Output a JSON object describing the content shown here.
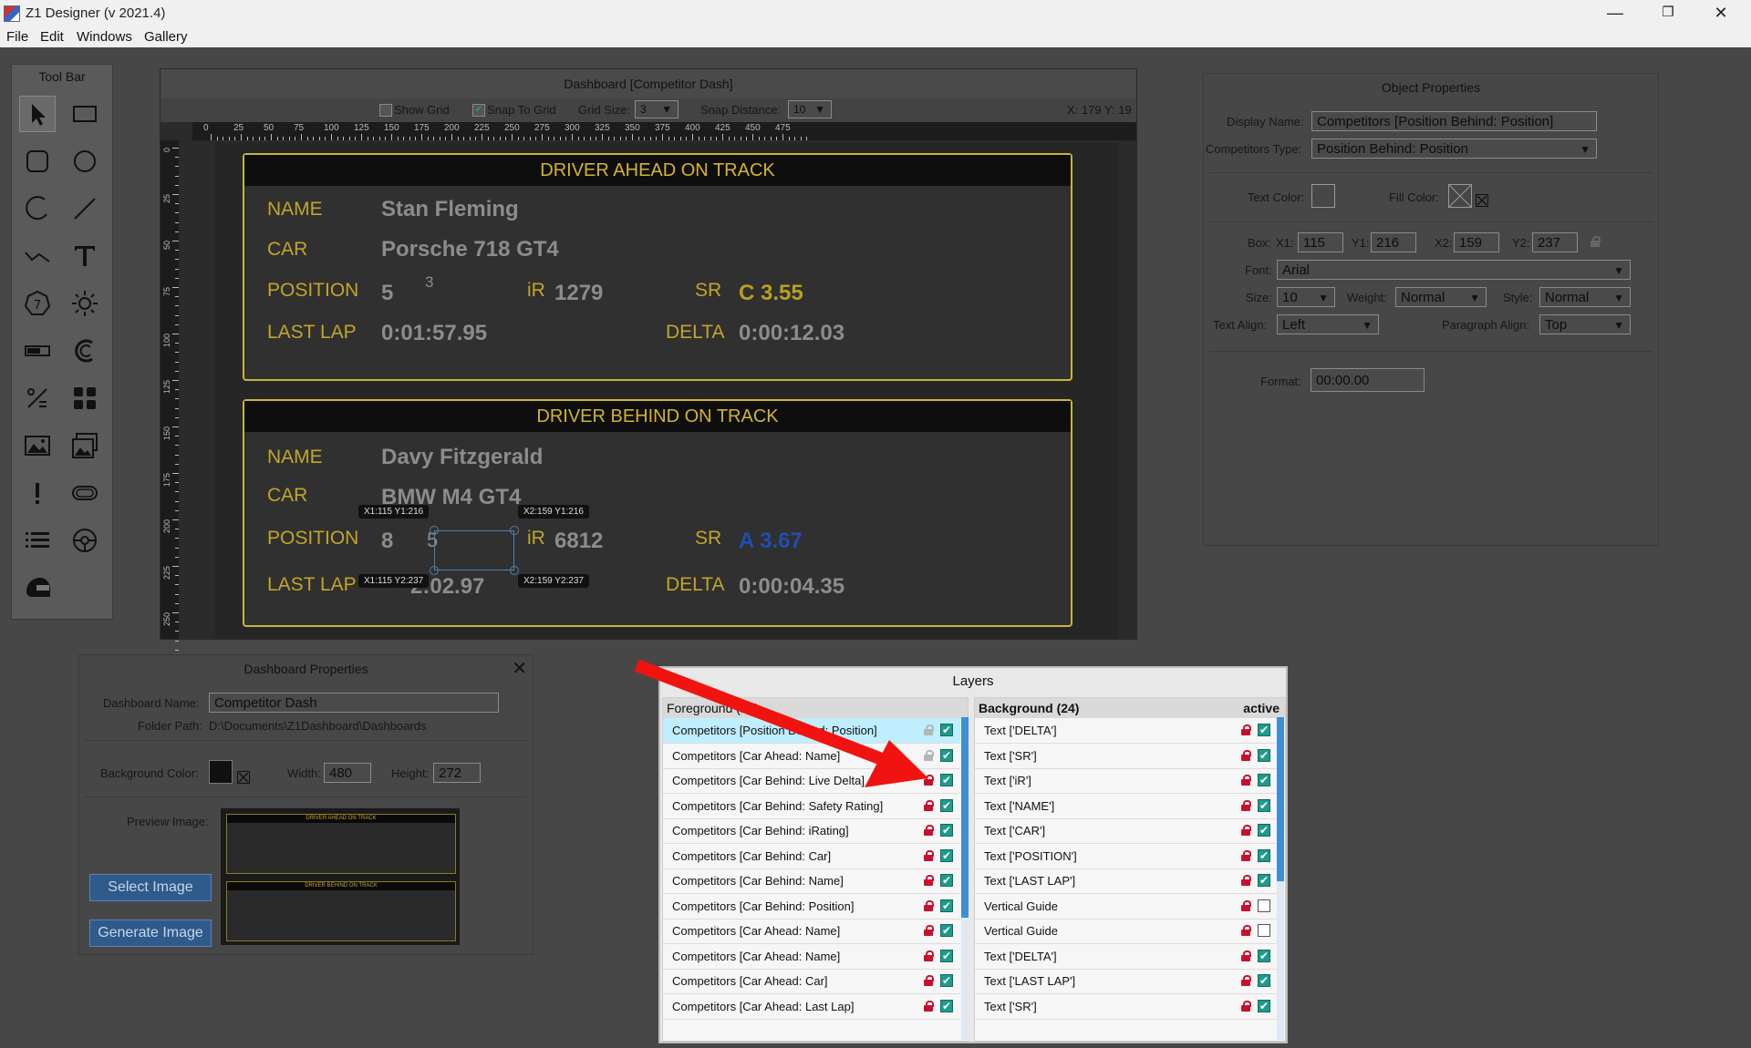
{
  "window": {
    "title": "Z1 Designer (v 2021.4)",
    "minimize": "—",
    "restore": "❐",
    "close": "✕"
  },
  "menu": [
    "File",
    "Edit",
    "Windows",
    "Gallery"
  ],
  "toolbar": {
    "title": "Tool Bar"
  },
  "designer": {
    "title": "Dashboard [Competitor Dash]",
    "show_grid": "Show Grid",
    "snap_to_grid": "Snap To Grid",
    "grid_size_label": "Grid Size:",
    "grid_size": "3",
    "snap_distance_label": "Snap Distance:",
    "snap_distance": "10",
    "coords": "X: 179 Y: 19",
    "ruler_h": [
      "0",
      "25",
      "50",
      "75",
      "100",
      "125",
      "150",
      "175",
      "200",
      "225",
      "250",
      "275",
      "300",
      "325",
      "350",
      "375",
      "400",
      "425",
      "450",
      "475"
    ],
    "ruler_v": [
      "0",
      "25",
      "50",
      "75",
      "100",
      "125",
      "150",
      "175",
      "200",
      "225",
      "250"
    ]
  },
  "dashboard": {
    "ahead": {
      "header": "DRIVER AHEAD ON TRACK",
      "name_label": "NAME",
      "name": "Stan Fleming",
      "car_label": "CAR",
      "car": "Porsche 718 GT4",
      "position_label": "POSITION",
      "position": "5",
      "position_small": "3",
      "ir_label": "iR",
      "ir": "1279",
      "sr_label": "SR",
      "sr": "C 3.55",
      "lastlap_label": "LAST LAP",
      "lastlap": "0:01:57.95",
      "delta_label": "DELTA",
      "delta": "0:00:12.03"
    },
    "behind": {
      "header": "DRIVER BEHIND ON TRACK",
      "name_label": "NAME",
      "name": "Davy Fitzgerald",
      "car_label": "CAR",
      "car": "BMW M4 GT4",
      "position_label": "POSITION",
      "position": "8",
      "position_small": "5",
      "ir_label": "iR",
      "ir": "6812",
      "sr_label": "SR",
      "sr": "A 3.67",
      "lastlap_label": "LAST LAP",
      "lastlap": "0:02:02.97",
      "lastlap_visible": "2:02.97",
      "delta_label": "DELTA",
      "delta": "0:00:04.35"
    },
    "handles": {
      "tl": "X1:115 Y1:216",
      "tr": "X2:159 Y1:216",
      "bl": "X1:115 Y2:237",
      "br": "X2:159 Y2:237"
    },
    "colors": {
      "accent": "#c2a52a",
      "sr_ahead": "#b8a01e",
      "sr_behind": "#1e4fb0"
    }
  },
  "object_properties": {
    "title": "Object Properties",
    "display_name_label": "Display Name:",
    "display_name": "Competitors [Position Behind: Position]",
    "competitors_type_label": "Competitors Type:",
    "competitors_type": "Position Behind: Position",
    "text_color_label": "Text Color:",
    "fill_color_label": "Fill Color:",
    "box_label": "Box:",
    "x1_label": "X1:",
    "x1": "115",
    "y1_label": "Y1:",
    "y1": "216",
    "x2_label": "X2:",
    "x2": "159",
    "y2_label": "Y2:",
    "y2": "237",
    "font_label": "Font:",
    "font": "Arial",
    "size_label": "Size:",
    "size": "10",
    "weight_label": "Weight:",
    "weight": "Normal",
    "style_label": "Style:",
    "style": "Normal",
    "text_align_label": "Text Align:",
    "text_align": "Left",
    "paragraph_align_label": "Paragraph Align:",
    "paragraph_align": "Top",
    "format_label": "Format:",
    "format": "00:00.00"
  },
  "dashboard_properties": {
    "title": "Dashboard Properties",
    "name_label": "Dashboard Name:",
    "name": "Competitor Dash",
    "folder_label": "Folder Path:",
    "folder": "D:\\Documents\\Z1Dashboard\\Dashboards",
    "bg_label": "Background Color:",
    "width_label": "Width:",
    "width": "480",
    "height_label": "Height:",
    "height": "272",
    "preview_label": "Preview Image:",
    "select_image": "Select Image",
    "generate_image": "Generate Image"
  },
  "layers": {
    "title": "Layers",
    "foreground_header": "Foreground (16)",
    "background_header": "Background (24)",
    "active_label": "active",
    "foreground": [
      {
        "label": "Competitors [Position Behind: Position]",
        "locked": false,
        "active": true,
        "selected": true
      },
      {
        "label": "Competitors [Car Ahead: Name]",
        "locked": false,
        "active": true
      },
      {
        "label": "Competitors [Car Behind: Live Delta]",
        "locked": true,
        "active": true
      },
      {
        "label": "Competitors [Car Behind: Safety Rating]",
        "locked": true,
        "active": true
      },
      {
        "label": "Competitors [Car Behind: iRating]",
        "locked": true,
        "active": true
      },
      {
        "label": "Competitors [Car Behind: Car]",
        "locked": true,
        "active": true
      },
      {
        "label": "Competitors [Car Behind: Name]",
        "locked": true,
        "active": true
      },
      {
        "label": "Competitors [Car Behind: Position]",
        "locked": true,
        "active": true
      },
      {
        "label": "Competitors [Car Ahead: Name]",
        "locked": true,
        "active": true
      },
      {
        "label": "Competitors [Car Ahead: Name]",
        "locked": true,
        "active": true
      },
      {
        "label": "Competitors [Car Ahead: Car]",
        "locked": true,
        "active": true
      },
      {
        "label": "Competitors [Car Ahead: Last Lap]",
        "locked": true,
        "active": true
      }
    ],
    "background": [
      {
        "label": "Text ['DELTA']",
        "locked": true,
        "active": true
      },
      {
        "label": "Text ['SR']",
        "locked": true,
        "active": true
      },
      {
        "label": "Text ['iR']",
        "locked": true,
        "active": true
      },
      {
        "label": "Text ['NAME']",
        "locked": true,
        "active": true
      },
      {
        "label": "Text ['CAR']",
        "locked": true,
        "active": true
      },
      {
        "label": "Text ['POSITION']",
        "locked": true,
        "active": true
      },
      {
        "label": "Text ['LAST LAP']",
        "locked": true,
        "active": true
      },
      {
        "label": "Vertical Guide",
        "locked": true,
        "active": false
      },
      {
        "label": "Vertical Guide",
        "locked": true,
        "active": false
      },
      {
        "label": "Text ['DELTA']",
        "locked": true,
        "active": true
      },
      {
        "label": "Text ['LAST LAP']",
        "locked": true,
        "active": true
      },
      {
        "label": "Text ['SR']",
        "locked": true,
        "active": true
      }
    ]
  },
  "preview": {
    "ahead_header": "DRIVER AHEAD ON TRACK",
    "behind_header": "DRIVER BEHIND ON TRACK"
  }
}
